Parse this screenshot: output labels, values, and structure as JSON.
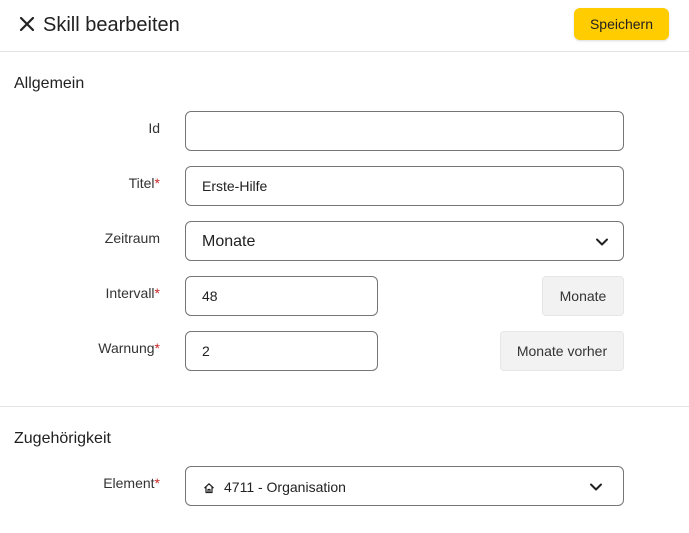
{
  "header": {
    "title": "Skill bearbeiten",
    "save_label": "Speichern",
    "accent_color": "#ffcc00"
  },
  "sections": {
    "general": {
      "title": "Allgemein",
      "id_label": "Id",
      "id_value": "",
      "title_label": "Titel",
      "title_value": "Erste-Hilfe",
      "period_label": "Zeitraum",
      "period_value": "Monate",
      "interval_label": "Intervall",
      "interval_value": "48",
      "interval_unit": "Monate",
      "warning_label": "Warnung",
      "warning_value": "2",
      "warning_unit": "Monate vorher",
      "required_mark": "*"
    },
    "membership": {
      "title": "Zugehörigkeit",
      "element_label": "Element",
      "element_value": "4711 - Organisation",
      "element_icon": "home-icon"
    }
  },
  "icons": {
    "close": "close-icon",
    "chevron": "chevron-down-icon"
  },
  "colors": {
    "required": "#c62828",
    "border": "#757575"
  }
}
